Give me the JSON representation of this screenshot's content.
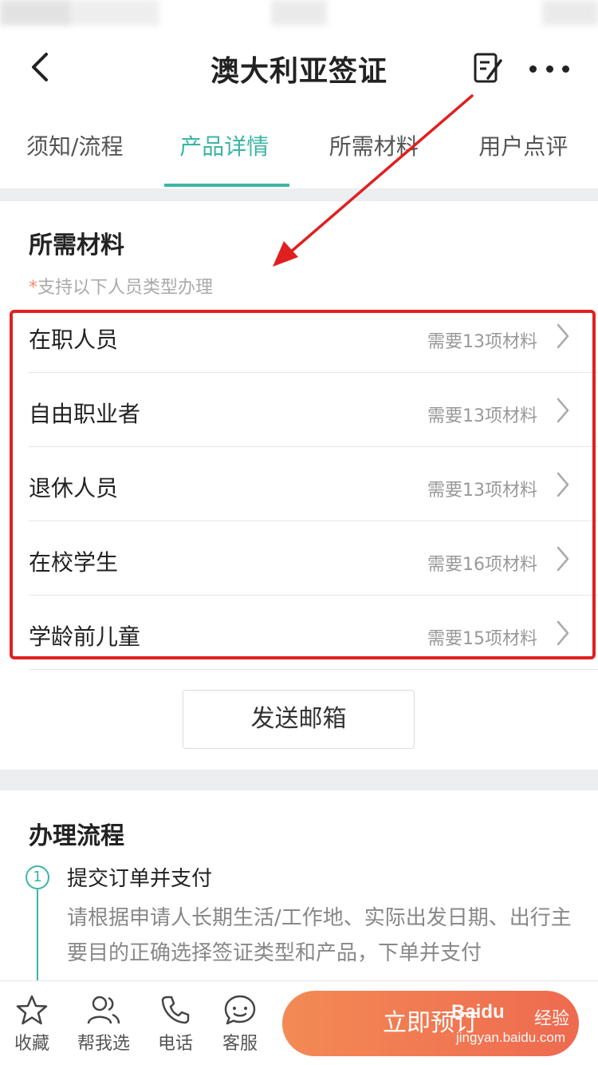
{
  "header": {
    "title": "澳大利亚签证",
    "back_icon": "chevron-left-icon",
    "edit_icon": "note-edit-icon",
    "more_icon": "more-dots-icon"
  },
  "tabs": [
    {
      "label": "须知/流程",
      "active": false
    },
    {
      "label": "产品详情",
      "active": true
    },
    {
      "label": "所需材料",
      "active": false
    },
    {
      "label": "用户点评",
      "active": false
    }
  ],
  "materials": {
    "title": "所需材料",
    "hint_star": "*",
    "hint": "支持以下人员类型办理",
    "items": [
      {
        "label": "在职人员",
        "count": "需要13项材料"
      },
      {
        "label": "自由职业者",
        "count": "需要13项材料"
      },
      {
        "label": "退休人员",
        "count": "需要13项材料"
      },
      {
        "label": "在校学生",
        "count": "需要16项材料"
      },
      {
        "label": "学龄前儿童",
        "count": "需要15项材料"
      }
    ],
    "send_email": "发送邮箱"
  },
  "process": {
    "title": "办理流程",
    "steps": [
      {
        "number": "1",
        "title": "提交订单并支付",
        "desc": "请根据申请人长期生活/工作地、实际出发日期、出行主要目的正确选择签证类型和产品，下单并支付"
      }
    ]
  },
  "bottom_bar": {
    "items": [
      {
        "label": "收藏",
        "icon": "star-icon"
      },
      {
        "label": "帮我选",
        "icon": "users-icon"
      },
      {
        "label": "电话",
        "icon": "phone-icon"
      },
      {
        "label": "客服",
        "icon": "chat-bubble-icon"
      }
    ],
    "book_button": "立即预订"
  },
  "watermark": {
    "logo": "Baidu",
    "text": "经验",
    "url": "jingyan.baidu.com"
  },
  "colors": {
    "accent": "#3cb5a4",
    "highlight": "#e02020",
    "book_button": "#ee6a50"
  }
}
